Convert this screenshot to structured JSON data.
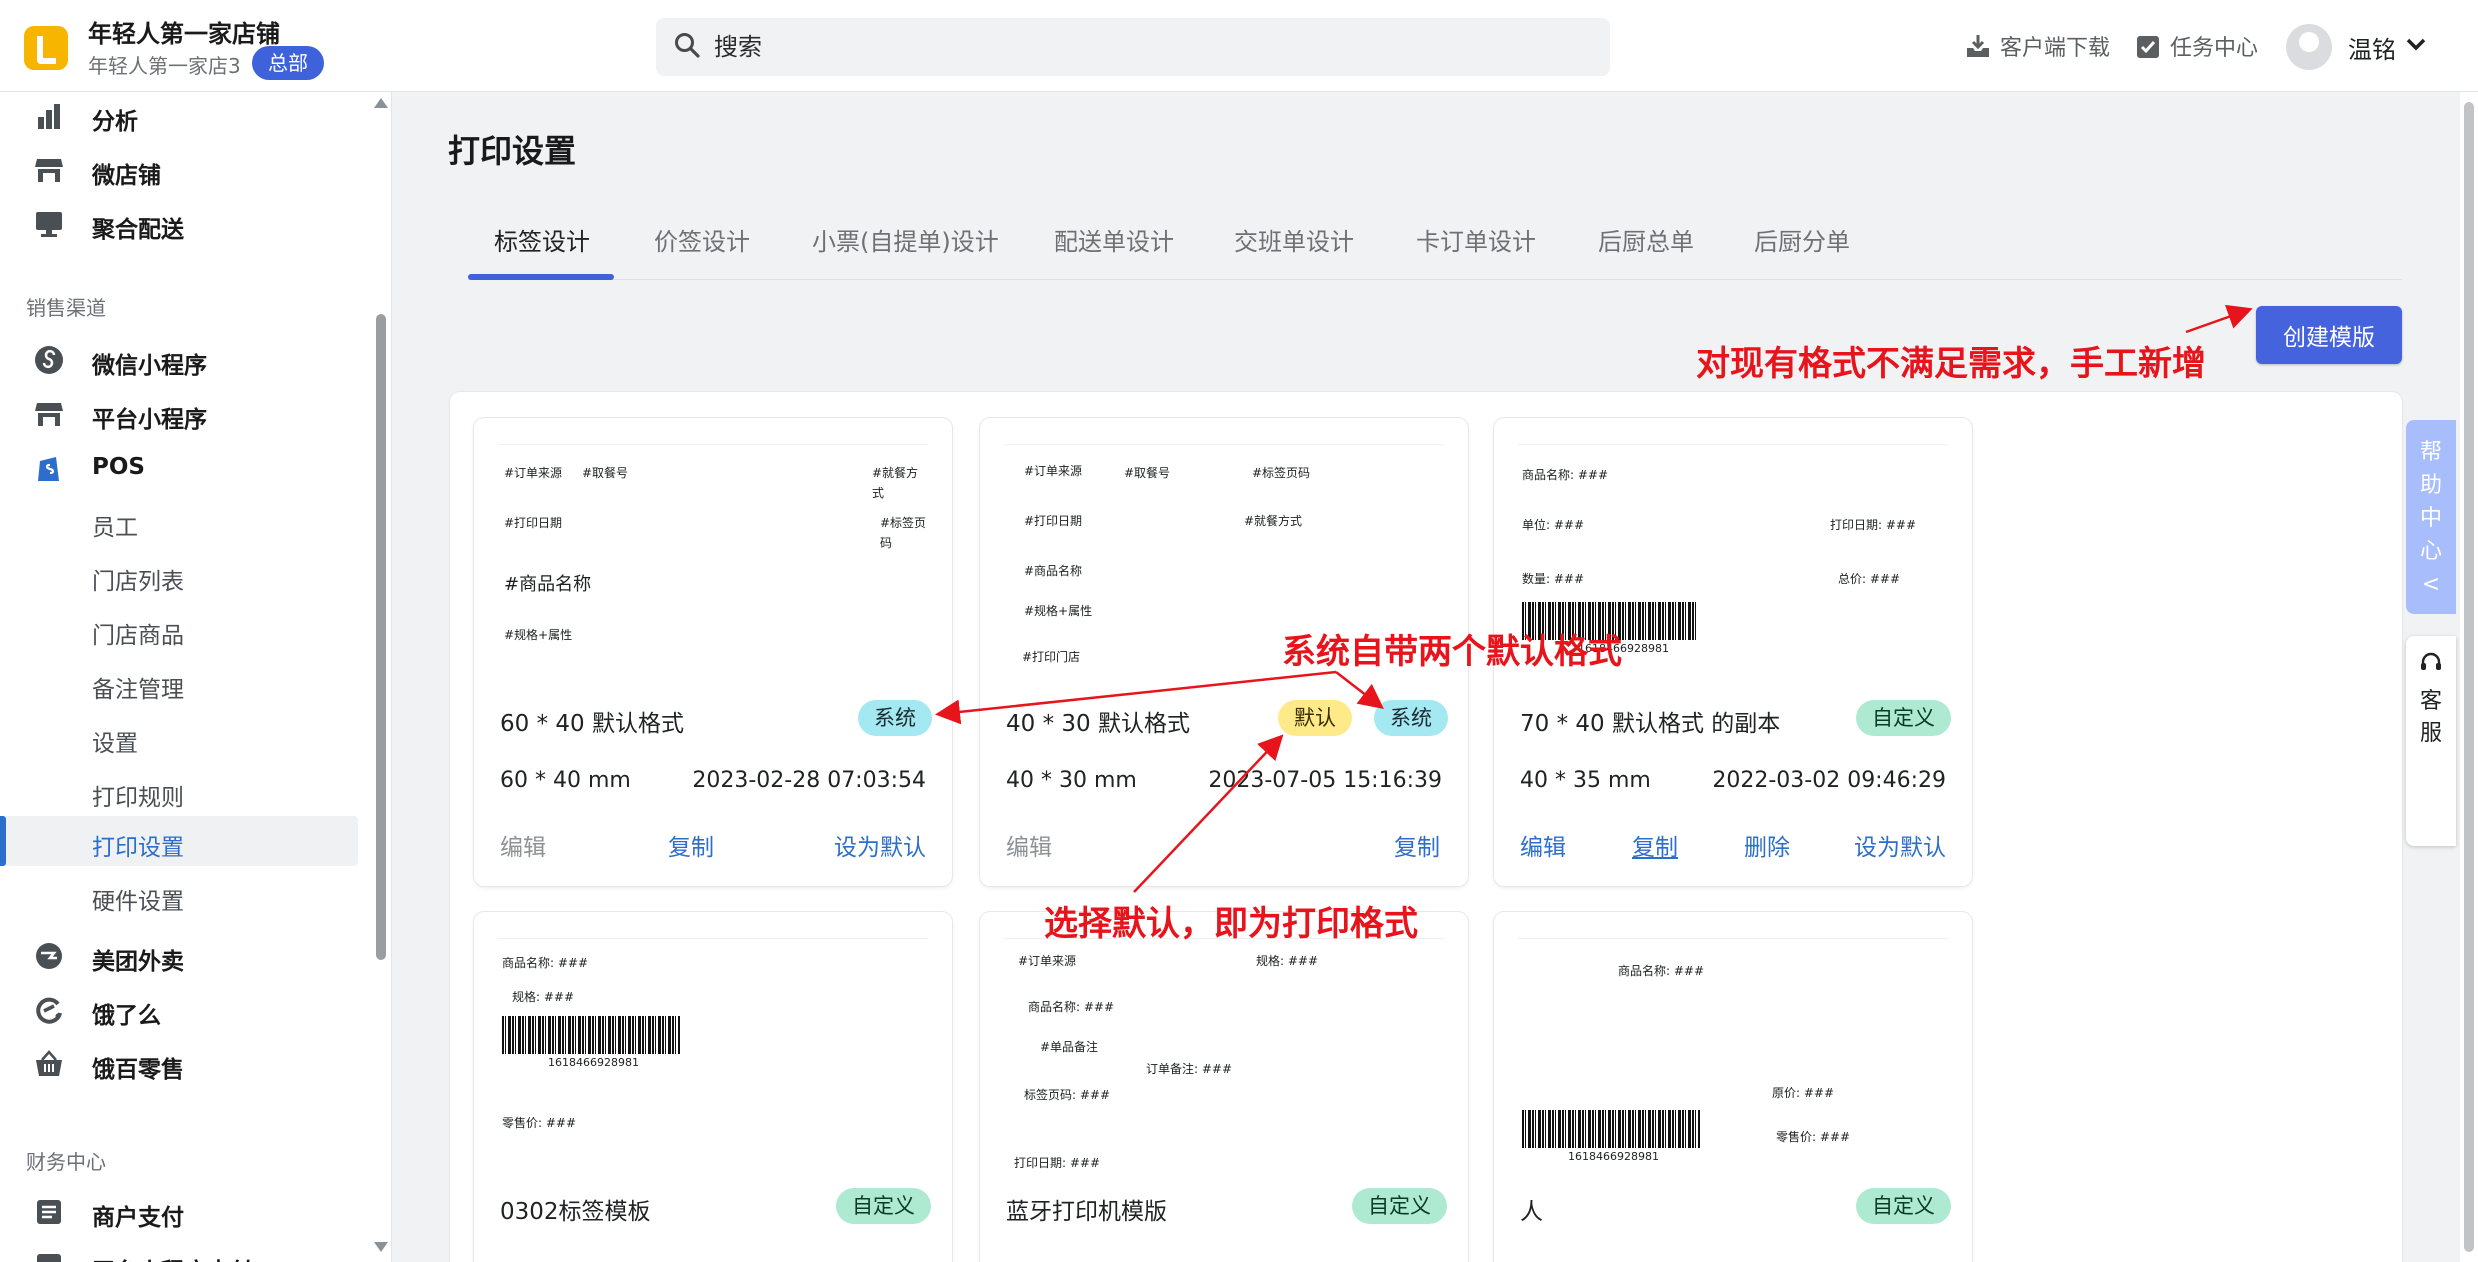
{
  "header": {
    "store_name": "年轻人第一家店铺",
    "store_sub": "年轻人第一家店3",
    "hq_badge": "总部",
    "search_placeholder": "搜索",
    "download": "客户端下载",
    "tasks": "任务中心",
    "user": "温铭"
  },
  "sidebar": {
    "top_items": [
      {
        "label": "分析",
        "icon": "bar-chart-icon"
      },
      {
        "label": "微店铺",
        "icon": "store-icon"
      },
      {
        "label": "聚合配送",
        "icon": "monitor-icon"
      }
    ],
    "sales_title": "销售渠道",
    "channels": [
      {
        "label": "微信小程序",
        "icon": "mini-program-icon"
      },
      {
        "label": "平台小程序",
        "icon": "store-icon"
      },
      {
        "label": "POS",
        "icon": "shopping-bag-icon"
      }
    ],
    "pos_sub": [
      "员工",
      "门店列表",
      "门店商品",
      "备注管理",
      "设置",
      "打印规则",
      "打印设置",
      "硬件设置"
    ],
    "delivery": [
      {
        "label": "美团外卖",
        "icon": "meituan-icon"
      },
      {
        "label": "饿了么",
        "icon": "eleme-icon"
      },
      {
        "label": "饿百零售",
        "icon": "basket-icon"
      }
    ],
    "finance_title": "财务中心",
    "finance": [
      {
        "label": "商户支付",
        "icon": "list-icon"
      },
      {
        "label": "平台小程序支付",
        "icon": "payment-icon"
      }
    ]
  },
  "main": {
    "title": "打印设置",
    "tabs": [
      "标签设计",
      "价签设计",
      "小票(自提单)设计",
      "配送单设计",
      "交班单设计",
      "卡订单设计",
      "后厨总单",
      "后厨分单"
    ],
    "create_button": "创建模版"
  },
  "cards": [
    {
      "name": "60 * 40 默认格式",
      "badges": [
        "系统"
      ],
      "size": "60 * 40 mm",
      "date": "2023-02-28 07:03:54",
      "actions": [
        "编辑",
        "复制",
        "设为默认"
      ],
      "preview": [
        "#订单来源",
        "#取餐号",
        "#就餐方",
        "式",
        "#打印日期",
        "#标签页",
        "码",
        "#商品名称",
        "#规格+属性"
      ]
    },
    {
      "name": "40 * 30 默认格式",
      "badges": [
        "默认",
        "系统"
      ],
      "size": "40 * 30 mm",
      "date": "2023-07-05 15:16:39",
      "actions": [
        "编辑",
        "复制"
      ],
      "preview": [
        "#订单来源",
        "#取餐号",
        "#标签页码",
        "#打印日期",
        "#就餐方式",
        "#商品名称",
        "#规格+属性",
        "#打印门店"
      ]
    },
    {
      "name": "70 * 40 默认格式 的副本",
      "badges": [
        "自定义"
      ],
      "size": "40 * 35 mm",
      "date": "2022-03-02 09:46:29",
      "actions": [
        "编辑",
        "复制",
        "删除",
        "设为默认"
      ],
      "preview": [
        "商品名称: ###",
        "单位: ###",
        "打印日期: ###",
        "数量: ###",
        "总价: ###",
        "1618466928981"
      ]
    },
    {
      "name": "0302标签模板",
      "badges": [
        "自定义"
      ],
      "preview": [
        "商品名称: ###",
        "规格: ###",
        "1618466928981",
        "零售价: ###"
      ]
    },
    {
      "name": "蓝牙打印机模版",
      "badges": [
        "自定义"
      ],
      "preview": [
        "#订单来源",
        "规格: ###",
        "商品名称: ###",
        "#单品备注",
        "订单备注: ###",
        "标签页码: ###",
        "打印日期: ###"
      ]
    },
    {
      "name": "人",
      "badges": [
        "自定义"
      ],
      "preview": [
        "商品名称: ###",
        "原价: ###",
        "零售价: ###",
        "1618466928981"
      ]
    }
  ],
  "floating": {
    "help": [
      "帮",
      "助",
      "中",
      "心",
      "<"
    ],
    "service": [
      "客",
      "服"
    ]
  },
  "annotations": {
    "manual_add": "对现有格式不满足需求，手工新增",
    "two_defaults": "系统自带两个默认格式",
    "choose_default": "选择默认，即为打印格式"
  },
  "colors": {
    "primary": "#4563dc",
    "annotation": "#e8141b",
    "system_badge": "#a4e8f2",
    "default_badge": "#ffea8a",
    "custom_badge": "#aee9d1"
  }
}
